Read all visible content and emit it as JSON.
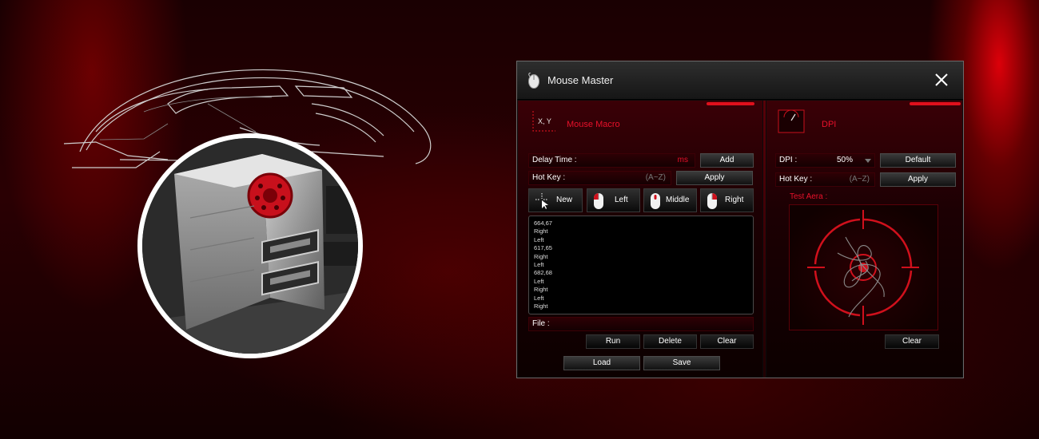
{
  "window": {
    "title": "Mouse Master",
    "close_icon": "close-icon",
    "app_icon": "mouse-icon"
  },
  "macro": {
    "section_title": "Mouse Macro",
    "section_icon_text": "X, Y",
    "delay_label": "Delay Time :",
    "delay_unit": "ms",
    "add_label": "Add",
    "hotkey_label": "Hot Key :",
    "hotkey_hint": "(A~Z)",
    "apply_label": "Apply",
    "tools": [
      {
        "label": "New",
        "icon": "cursor-target-icon"
      },
      {
        "label": "Left",
        "icon": "mouse-left-icon"
      },
      {
        "label": "Middle",
        "icon": "mouse-middle-icon"
      },
      {
        "label": "Right",
        "icon": "mouse-right-icon"
      }
    ],
    "events": [
      "664,67",
      "Right",
      "Left",
      "617,65",
      "Right",
      "Left",
      "682,68",
      "Left",
      "Right",
      "Left",
      "Right"
    ],
    "file_label": "File :",
    "run_label": "Run",
    "delete_label": "Delete",
    "clear_label": "Clear",
    "load_label": "Load",
    "save_label": "Save"
  },
  "dpi": {
    "section_title": "DPI",
    "dpi_label": "DPI :",
    "dpi_value": "50%",
    "default_label": "Default",
    "hotkey_label": "Hot Key :",
    "hotkey_hint": "(A~Z)",
    "apply_label": "Apply",
    "test_area_label": "Test Aera :",
    "clear_label": "Clear"
  },
  "colors": {
    "accent": "#e8102a",
    "window_bg": "#0b0b0b",
    "panel_red": "#3a0006"
  }
}
